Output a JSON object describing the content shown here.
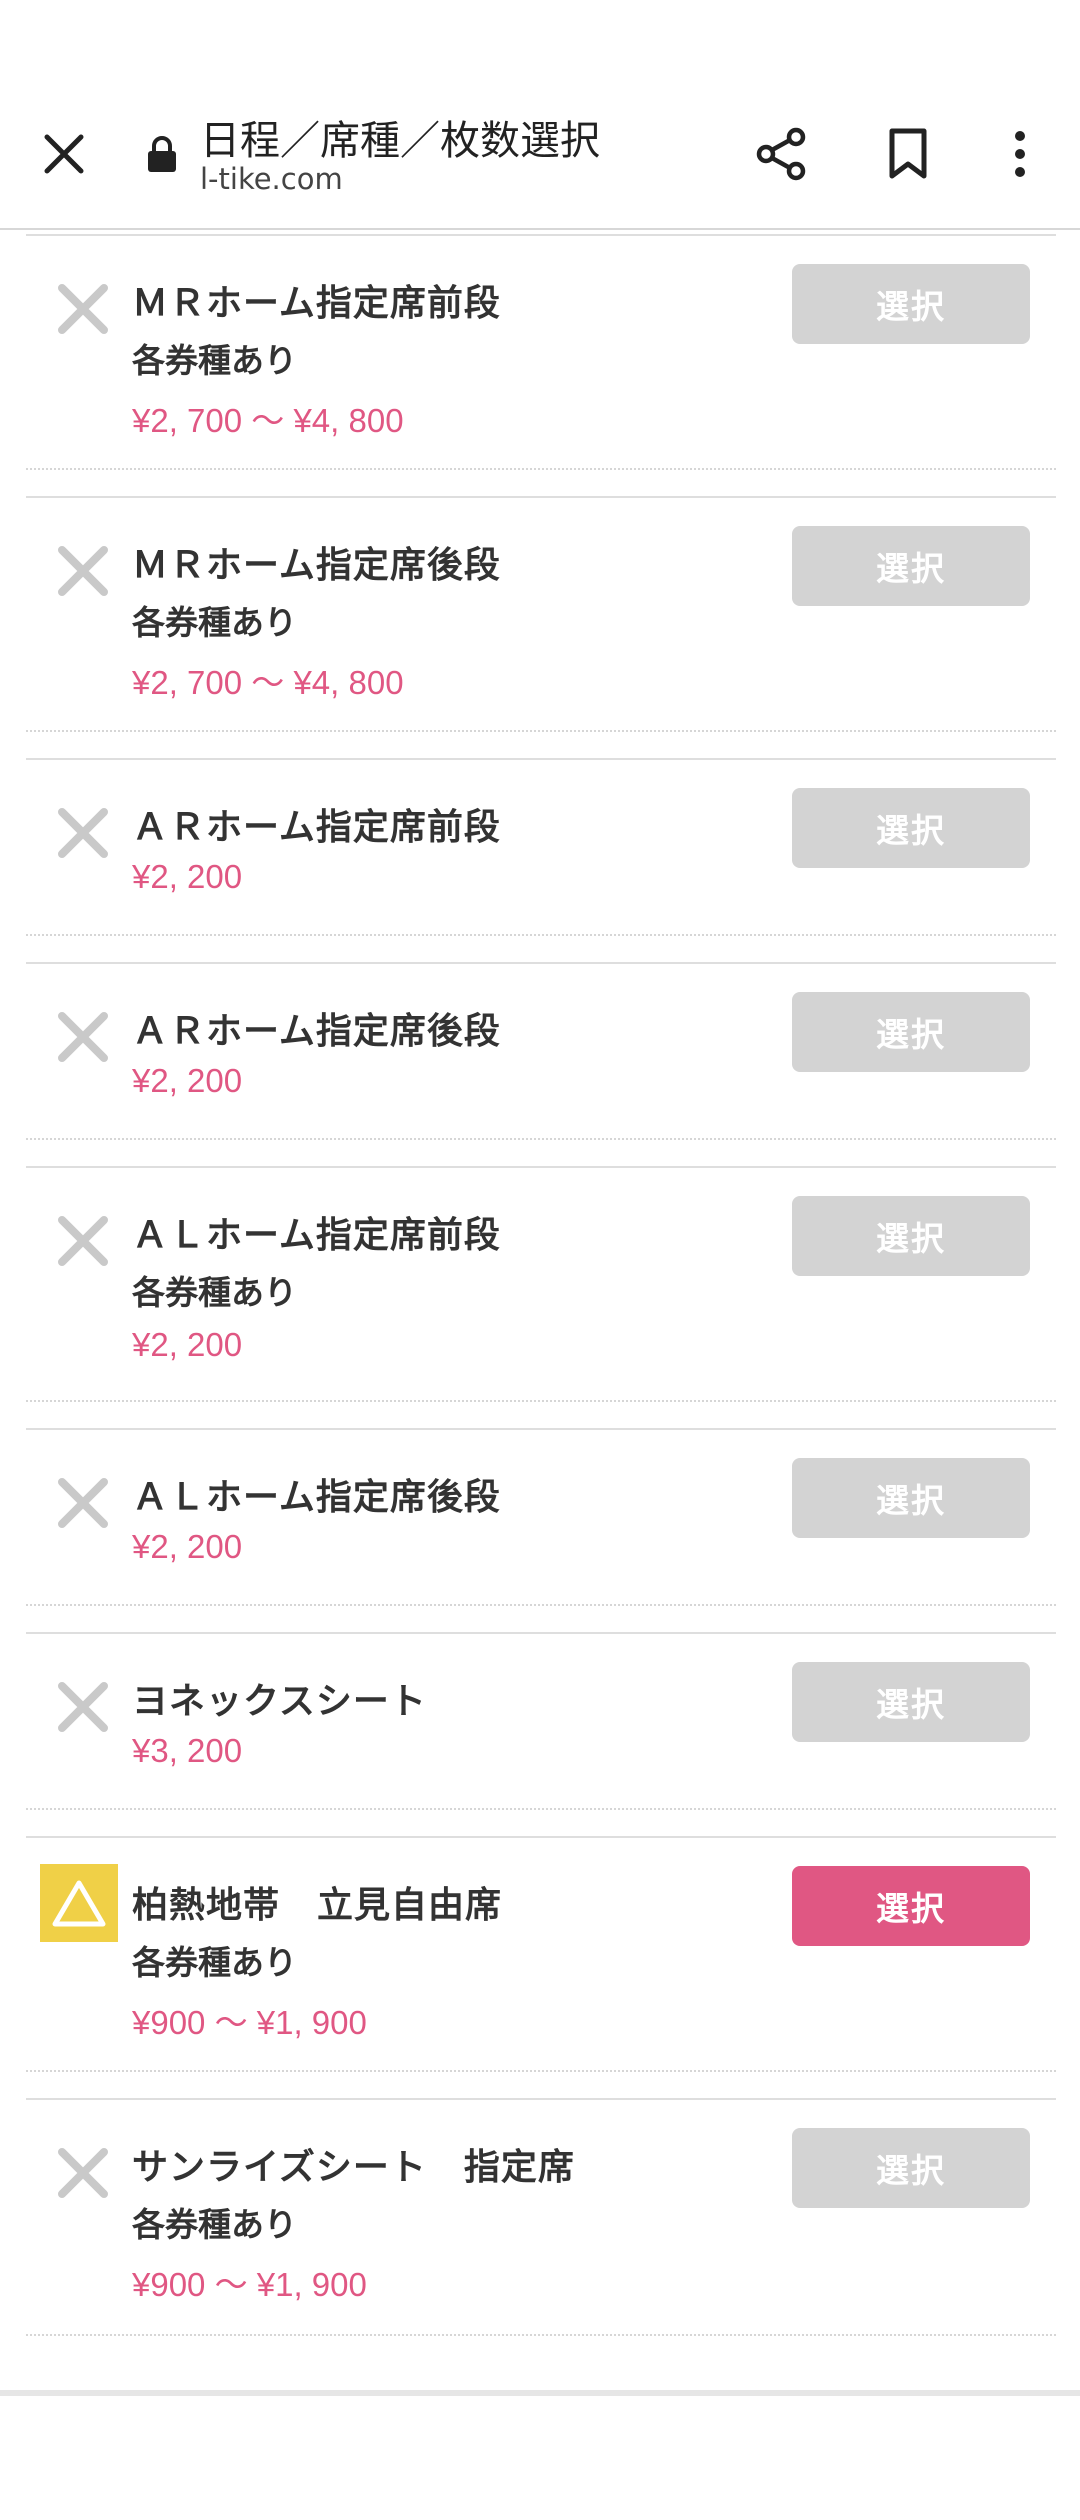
{
  "browser": {
    "title": "日程／席種／枚数選択",
    "url": "l-tike.com"
  },
  "colors": {
    "accent": "#e05783",
    "disabled": "#d3d3d3",
    "warning": "#f0d047"
  },
  "seats": [
    {
      "name": "ＭＲホーム指定席前段",
      "types": "各券種あり",
      "price": "¥2, 700 〜 ¥4, 800",
      "status": "sold-out",
      "select_label": "選択"
    },
    {
      "name": "ＭＲホーム指定席後段",
      "types": "各券種あり",
      "price": "¥2, 700 〜 ¥4, 800",
      "status": "sold-out",
      "select_label": "選択"
    },
    {
      "name": "ＡＲホーム指定席前段",
      "types": "",
      "price": "¥2, 200",
      "status": "sold-out",
      "select_label": "選択"
    },
    {
      "name": "ＡＲホーム指定席後段",
      "types": "",
      "price": "¥2, 200",
      "status": "sold-out",
      "select_label": "選択"
    },
    {
      "name": "ＡＬホーム指定席前段",
      "types": "各券種あり",
      "price": "¥2, 200",
      "status": "sold-out",
      "select_label": "選択"
    },
    {
      "name": "ＡＬホーム指定席後段",
      "types": "",
      "price": "¥2, 200",
      "status": "sold-out",
      "select_label": "選択"
    },
    {
      "name": "ヨネックスシート",
      "types": "",
      "price": "¥3, 200",
      "status": "sold-out",
      "select_label": "選択"
    },
    {
      "name": "柏熱地帯　立見自由席",
      "types": "各券種あり",
      "price": "¥900 〜 ¥1, 900",
      "status": "few-left",
      "select_label": "選択"
    },
    {
      "name": "サンライズシート　指定席",
      "types": "各券種あり",
      "price": "¥900 〜 ¥1, 900",
      "status": "sold-out",
      "select_label": "選択"
    }
  ]
}
